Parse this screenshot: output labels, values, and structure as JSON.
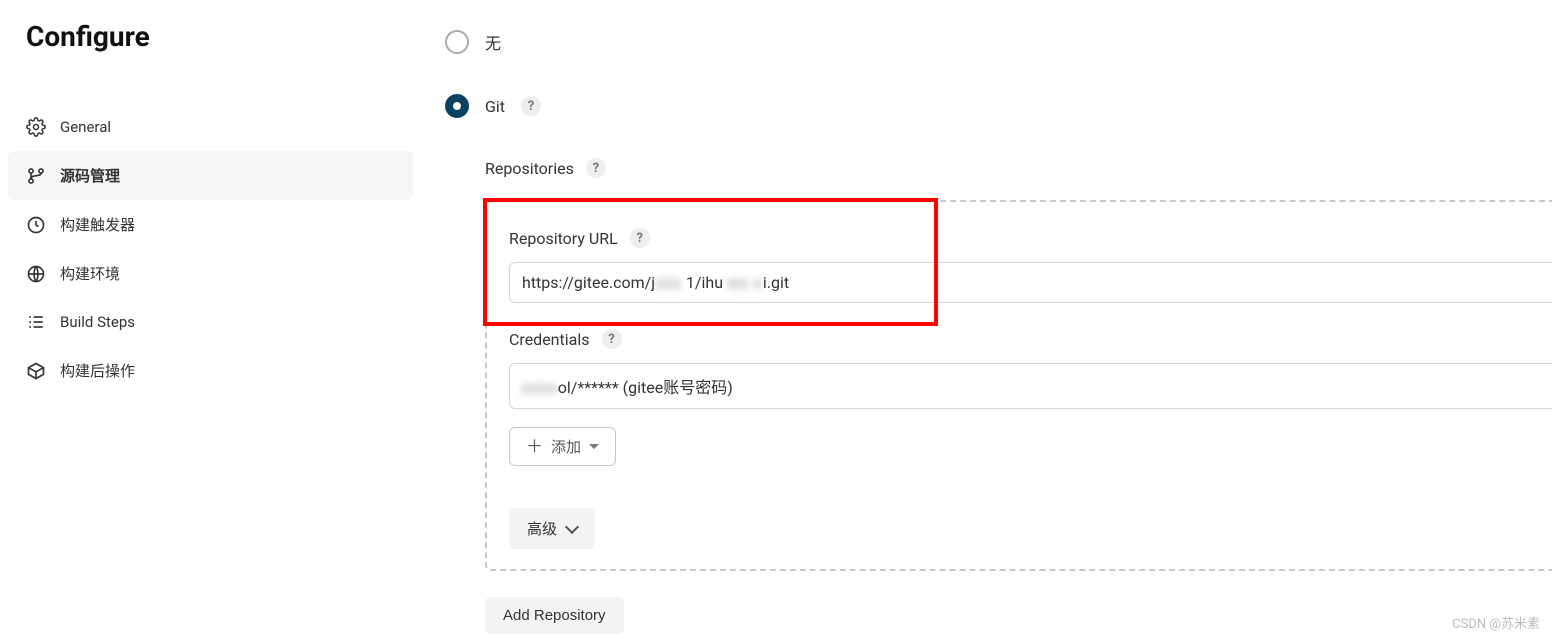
{
  "page": {
    "title": "Configure"
  },
  "sidebar": {
    "items": [
      {
        "label": "General",
        "active": false
      },
      {
        "label": "源码管理",
        "active": true
      },
      {
        "label": "构建触发器",
        "active": false
      },
      {
        "label": "构建环境",
        "active": false
      },
      {
        "label": "Build Steps",
        "active": false
      },
      {
        "label": "构建后操作",
        "active": false
      }
    ]
  },
  "scm": {
    "options": {
      "none": {
        "label": "无",
        "selected": false
      },
      "git": {
        "label": "Git",
        "selected": true
      }
    },
    "repositories_label": "Repositories",
    "repository_url_label": "Repository URL",
    "repository_url_value_prefix": "https://gitee.com/j",
    "repository_url_value_obscured1": "xxx",
    "repository_url_value_mid": " 1/ihu ",
    "repository_url_value_obscured2": "wx   x",
    "repository_url_value_suffix": "i.git",
    "credentials_label": "Credentials",
    "credentials_value_obscured": "xxxx",
    "credentials_value_suffix": "ol/****** (gitee账号密码)",
    "add_button_label": "添加",
    "advanced_button_label": "高级",
    "add_repository_button_label": "Add Repository"
  },
  "watermark": "CSDN @苏米素"
}
